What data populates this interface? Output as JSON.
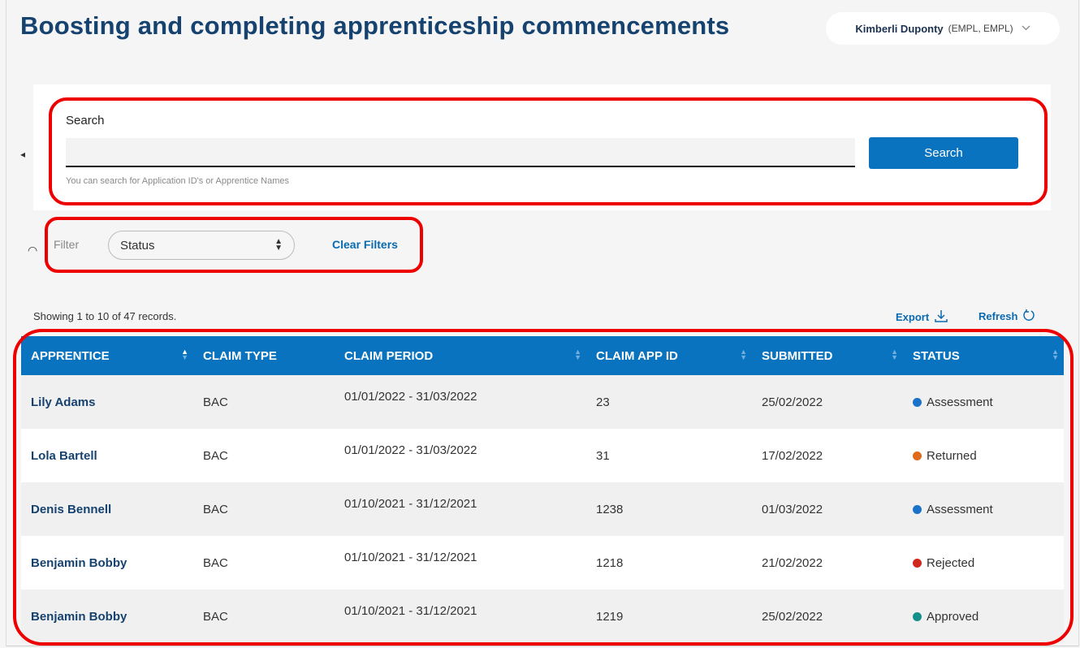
{
  "header": {
    "title": "Boosting and completing apprenticeship commencements",
    "user_name": "Kimberli Duponty",
    "user_role": "(EMPL, EMPL)"
  },
  "search": {
    "label": "Search",
    "value": "",
    "hint": "You can search for Application ID's or Apprentice Names",
    "button": "Search"
  },
  "filter": {
    "label": "Filter",
    "status_selected": "Status",
    "clear": "Clear Filters"
  },
  "records": {
    "showing": "Showing 1 to 10 of 47 records.",
    "export": "Export",
    "refresh": "Refresh"
  },
  "table": {
    "columns": [
      "APPRENTICE",
      "CLAIM TYPE",
      "CLAIM PERIOD",
      "CLAIM APP ID",
      "SUBMITTED",
      "STATUS"
    ],
    "rows": [
      {
        "apprentice": "Lily Adams",
        "claim_type": "BAC",
        "period": "01/01/2022 - 31/03/2022",
        "app_id": "23",
        "submitted": "25/02/2022",
        "status": "Assessment"
      },
      {
        "apprentice": "Lola Bartell",
        "claim_type": "BAC",
        "period": "01/01/2022 - 31/03/2022",
        "app_id": "31",
        "submitted": "17/02/2022",
        "status": "Returned"
      },
      {
        "apprentice": "Denis Bennell",
        "claim_type": "BAC",
        "period": "01/10/2021 - 31/12/2021",
        "app_id": "1238",
        "submitted": "01/03/2022",
        "status": "Assessment"
      },
      {
        "apprentice": "Benjamin Bobby",
        "claim_type": "BAC",
        "period": "01/10/2021 - 31/12/2021",
        "app_id": "1218",
        "submitted": "21/02/2022",
        "status": "Rejected"
      },
      {
        "apprentice": "Benjamin Bobby",
        "claim_type": "BAC",
        "period": "01/10/2021 - 31/12/2021",
        "app_id": "1219",
        "submitted": "25/02/2022",
        "status": "Approved"
      }
    ]
  },
  "status_colors": {
    "Assessment": "#1a73c8",
    "Returned": "#e06a1a",
    "Rejected": "#d0281f",
    "Approved": "#14908a"
  },
  "icons": {
    "export": "download-icon",
    "refresh": "refresh-icon",
    "user_menu": "chevron-down-icon"
  }
}
